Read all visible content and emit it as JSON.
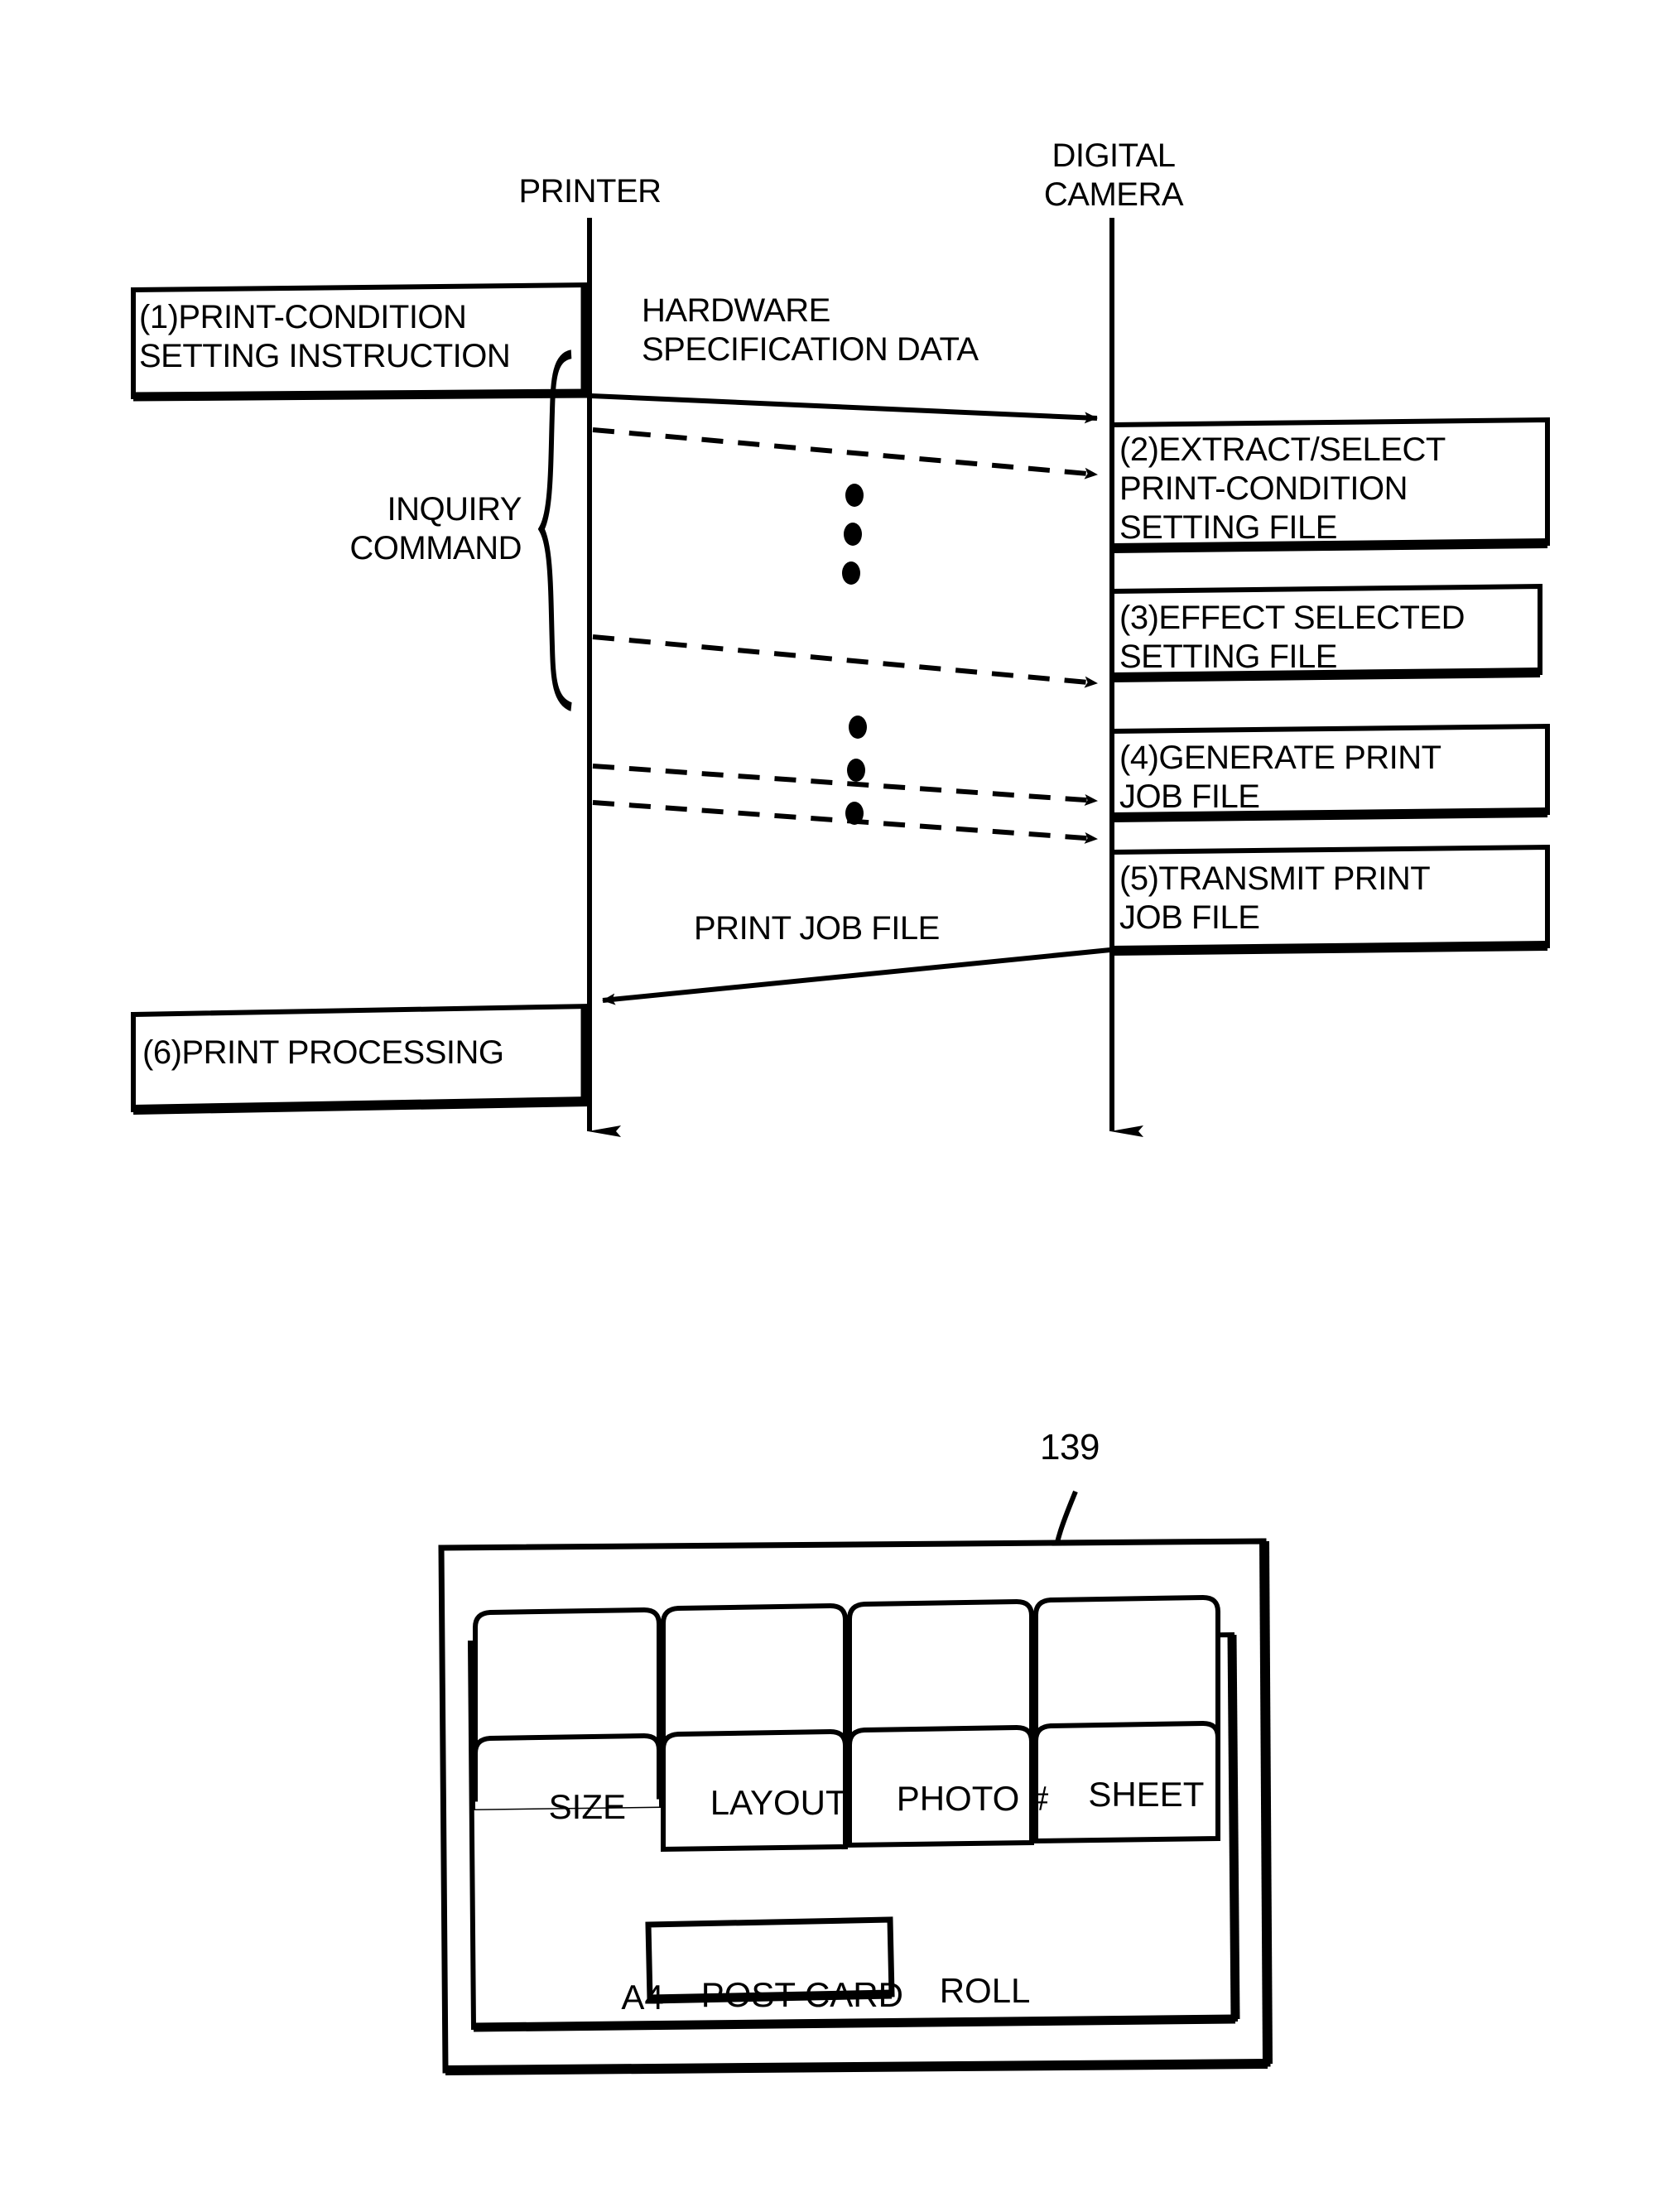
{
  "figure": {
    "type": "sequence-diagram",
    "lifelines": [
      {
        "id": "printer",
        "label": "PRINTER"
      },
      {
        "id": "digital_camera",
        "label": "DIGITAL\nCAMERA"
      }
    ],
    "steps": [
      {
        "id": "step1",
        "side": "printer",
        "text": "(1)PRINT-CONDITION\nSETTING INSTRUCTION"
      },
      {
        "id": "step2",
        "side": "camera",
        "text": "(2)EXTRACT/SELECT\nPRINT-CONDITION\nSETTING FILE"
      },
      {
        "id": "step3",
        "side": "camera",
        "text": "(3)EFFECT SELECTED\nSETTING FILE"
      },
      {
        "id": "step4",
        "side": "camera",
        "text": "(4)GENERATE PRINT\nJOB FILE"
      },
      {
        "id": "step5",
        "side": "camera",
        "text": "(5)TRANSMIT PRINT\nJOB FILE"
      },
      {
        "id": "step6",
        "side": "printer",
        "text": "(6)PRINT PROCESSING"
      }
    ],
    "messages": [
      {
        "id": "hardware_spec",
        "label": "HARDWARE\nSPECIFICATION DATA",
        "style": "solid",
        "direction": "printer-to-camera"
      },
      {
        "id": "inquiry",
        "label": "INQUIRY\nCOMMAND",
        "style": "dashed",
        "direction": "printer-to-camera"
      },
      {
        "id": "print_job",
        "label": "PRINT JOB FILE",
        "style": "solid",
        "direction": "camera-to-printer"
      }
    ],
    "vertical_dots_count": 3
  },
  "panel": {
    "reference_number": "139",
    "tabs": [
      {
        "label": "SIZE",
        "active": true
      },
      {
        "label": "LAYOUT",
        "active": false
      },
      {
        "label": "PHOTO #",
        "active": false
      },
      {
        "label": "SHEET",
        "active": false
      }
    ],
    "options": [
      {
        "label": "A4",
        "selected": false
      },
      {
        "label": "POST CARD",
        "selected": true
      },
      {
        "label": "ROLL",
        "selected": false
      }
    ]
  },
  "colors": {
    "ink": "#000000",
    "paper": "#ffffff"
  }
}
